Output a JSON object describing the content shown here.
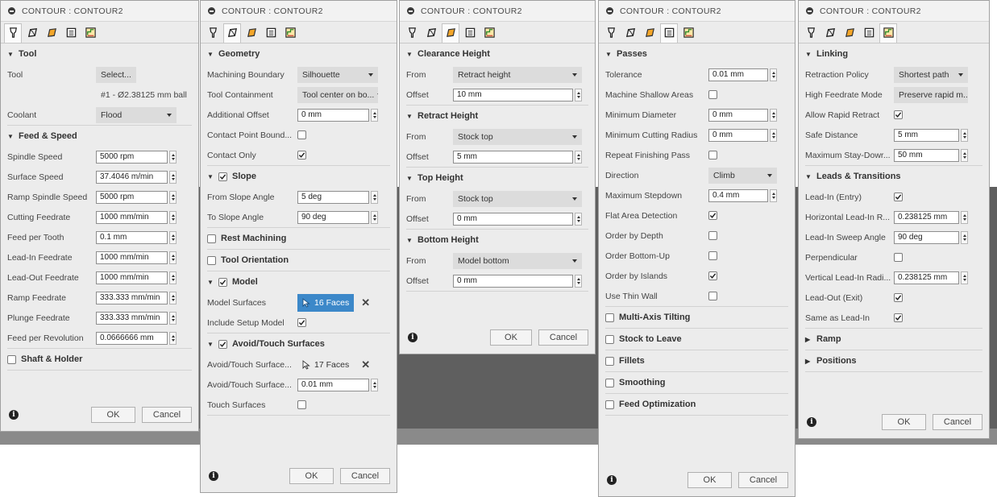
{
  "panels": [
    {
      "title": "CONTOUR : CONTOUR2",
      "active_tab": 0,
      "ok": "OK",
      "cancel": "Cancel",
      "sections": [
        {
          "head": "Tool",
          "arrow": "▼",
          "rows": [
            {
              "label": "Tool",
              "type": "select-btn",
              "value": "Select..."
            },
            {
              "label": "",
              "type": "text",
              "value": "#1 - Ø2.38125 mm ball"
            },
            {
              "label": "Coolant",
              "type": "select",
              "value": "Flood"
            }
          ]
        },
        {
          "head": "Feed & Speed",
          "arrow": "▼",
          "rows": [
            {
              "label": "Spindle Speed",
              "type": "input",
              "value": "5000 rpm"
            },
            {
              "label": "Surface Speed",
              "type": "input",
              "value": "37.4046 m/min"
            },
            {
              "label": "Ramp Spindle Speed",
              "type": "input",
              "value": "5000 rpm"
            },
            {
              "label": "Cutting Feedrate",
              "type": "input",
              "value": "1000 mm/min"
            },
            {
              "label": "Feed per Tooth",
              "type": "input",
              "value": "0.1 mm"
            },
            {
              "label": "Lead-In Feedrate",
              "type": "input",
              "value": "1000 mm/min"
            },
            {
              "label": "Lead-Out Feedrate",
              "type": "input",
              "value": "1000 mm/min"
            },
            {
              "label": "Ramp Feedrate",
              "type": "input",
              "value": "333.333 mm/min"
            },
            {
              "label": "Plunge Feedrate",
              "type": "input",
              "value": "333.333 mm/min"
            },
            {
              "label": "Feed per Revolution",
              "type": "input",
              "value": "0.0666666 mm"
            }
          ]
        },
        {
          "head": "Shaft & Holder",
          "check": false,
          "rows": []
        }
      ]
    },
    {
      "title": "CONTOUR : CONTOUR2",
      "active_tab": 1,
      "ok": "OK",
      "cancel": "Cancel",
      "sections": [
        {
          "head": "Geometry",
          "arrow": "▼",
          "rows": [
            {
              "label": "Machining Boundary",
              "type": "select",
              "value": "Silhouette"
            },
            {
              "label": "Tool Containment",
              "type": "select",
              "value": "Tool center on bo..."
            },
            {
              "label": "Additional Offset",
              "type": "input",
              "value": "0 mm"
            },
            {
              "label": "Contact Point Bound...",
              "type": "check",
              "value": false
            },
            {
              "label": "Contact Only",
              "type": "check",
              "value": true
            }
          ]
        },
        {
          "head": "Slope",
          "arrow": "▼",
          "check": true,
          "rows": [
            {
              "label": "From Slope Angle",
              "type": "input",
              "value": "5 deg"
            },
            {
              "label": "To Slope Angle",
              "type": "input",
              "value": "90 deg"
            }
          ]
        },
        {
          "head": "Rest Machining",
          "check": false,
          "rows": []
        },
        {
          "head": "Tool Orientation",
          "check": false,
          "rows": []
        },
        {
          "head": "Model",
          "arrow": "▼",
          "check": true,
          "rows": [
            {
              "label": "Model Surfaces",
              "type": "faces",
              "value": "16 Faces",
              "active": true
            },
            {
              "label": "Include Setup Model",
              "type": "check",
              "value": true
            }
          ]
        },
        {
          "head": "Avoid/Touch Surfaces",
          "arrow": "▼",
          "check": true,
          "rows": [
            {
              "label": "Avoid/Touch Surface...",
              "type": "faces",
              "value": "17 Faces",
              "active": false
            },
            {
              "label": "Avoid/Touch Surface...",
              "type": "input",
              "value": "0.01 mm"
            },
            {
              "label": "Touch Surfaces",
              "type": "check",
              "value": false
            }
          ]
        }
      ]
    },
    {
      "title": "CONTOUR : CONTOUR2",
      "active_tab": 2,
      "ok": "OK",
      "cancel": "Cancel",
      "sections": [
        {
          "head": "Clearance Height",
          "arrow": "▼",
          "rows": [
            {
              "label": "From",
              "type": "select",
              "value": "Retract height"
            },
            {
              "label": "Offset",
              "type": "input",
              "value": "10 mm"
            }
          ]
        },
        {
          "head": "Retract Height",
          "arrow": "▼",
          "rows": [
            {
              "label": "From",
              "type": "select",
              "value": "Stock top"
            },
            {
              "label": "Offset",
              "type": "input",
              "value": "5 mm"
            }
          ]
        },
        {
          "head": "Top Height",
          "arrow": "▼",
          "rows": [
            {
              "label": "From",
              "type": "select",
              "value": "Stock top"
            },
            {
              "label": "Offset",
              "type": "input",
              "value": "0 mm"
            }
          ]
        },
        {
          "head": "Bottom Height",
          "arrow": "▼",
          "rows": [
            {
              "label": "From",
              "type": "select",
              "value": "Model bottom"
            },
            {
              "label": "Offset",
              "type": "input",
              "value": "0 mm"
            }
          ]
        }
      ]
    },
    {
      "title": "CONTOUR : CONTOUR2",
      "active_tab": 3,
      "ok": "OK",
      "cancel": "Cancel",
      "sections": [
        {
          "head": "Passes",
          "arrow": "▼",
          "rows": [
            {
              "label": "Tolerance",
              "type": "input",
              "value": "0.01 mm"
            },
            {
              "label": "Machine Shallow Areas",
              "type": "check",
              "value": false
            },
            {
              "label": "Minimum Diameter",
              "type": "input",
              "value": "0 mm"
            },
            {
              "label": "Minimum Cutting Radius",
              "type": "input",
              "value": "0 mm"
            },
            {
              "label": "Repeat Finishing Pass",
              "type": "check",
              "value": false
            },
            {
              "label": "Direction",
              "type": "select",
              "value": "Climb"
            },
            {
              "label": "Maximum Stepdown",
              "type": "input",
              "value": "0.4 mm"
            },
            {
              "label": "Flat Area Detection",
              "type": "check",
              "value": true
            },
            {
              "label": "Order by Depth",
              "type": "check",
              "value": false
            },
            {
              "label": "Order Bottom-Up",
              "type": "check",
              "value": false
            },
            {
              "label": "Order by Islands",
              "type": "check",
              "value": true
            },
            {
              "label": "Use Thin Wall",
              "type": "check",
              "value": false
            }
          ]
        },
        {
          "head": "Multi-Axis Tilting",
          "check": false,
          "rows": []
        },
        {
          "head": "Stock to Leave",
          "check": false,
          "rows": []
        },
        {
          "head": "Fillets",
          "check": false,
          "rows": []
        },
        {
          "head": "Smoothing",
          "check": false,
          "rows": []
        },
        {
          "head": "Feed Optimization",
          "check": false,
          "rows": []
        }
      ]
    },
    {
      "title": "CONTOUR : CONTOUR2",
      "active_tab": 4,
      "ok": "OK",
      "cancel": "Cancel",
      "sections": [
        {
          "head": "Linking",
          "arrow": "▼",
          "rows": [
            {
              "label": "Retraction Policy",
              "type": "select",
              "value": "Shortest path"
            },
            {
              "label": "High Feedrate Mode",
              "type": "select",
              "value": "Preserve rapid m..."
            },
            {
              "label": "Allow Rapid Retract",
              "type": "check",
              "value": true
            },
            {
              "label": "Safe Distance",
              "type": "input",
              "value": "5 mm"
            },
            {
              "label": "Maximum Stay-Dowr...",
              "type": "input",
              "value": "50 mm"
            }
          ]
        },
        {
          "head": "Leads & Transitions",
          "arrow": "▼",
          "rows": [
            {
              "label": "Lead-In (Entry)",
              "type": "check",
              "value": true
            },
            {
              "label": "Horizontal Lead-In R...",
              "type": "input",
              "value": "0.238125 mm"
            },
            {
              "label": "Lead-In Sweep Angle",
              "type": "input",
              "value": "90 deg"
            },
            {
              "label": "Perpendicular",
              "type": "check",
              "value": false
            },
            {
              "label": "Vertical Lead-In Radi...",
              "type": "input",
              "value": "0.238125 mm"
            },
            {
              "label": "Lead-Out (Exit)",
              "type": "check",
              "value": true
            },
            {
              "label": "Same as Lead-In",
              "type": "check",
              "value": true
            }
          ]
        },
        {
          "head": "Ramp",
          "arrow": "▶",
          "rows": []
        },
        {
          "head": "Positions",
          "arrow": "▶",
          "rows": []
        }
      ]
    }
  ]
}
